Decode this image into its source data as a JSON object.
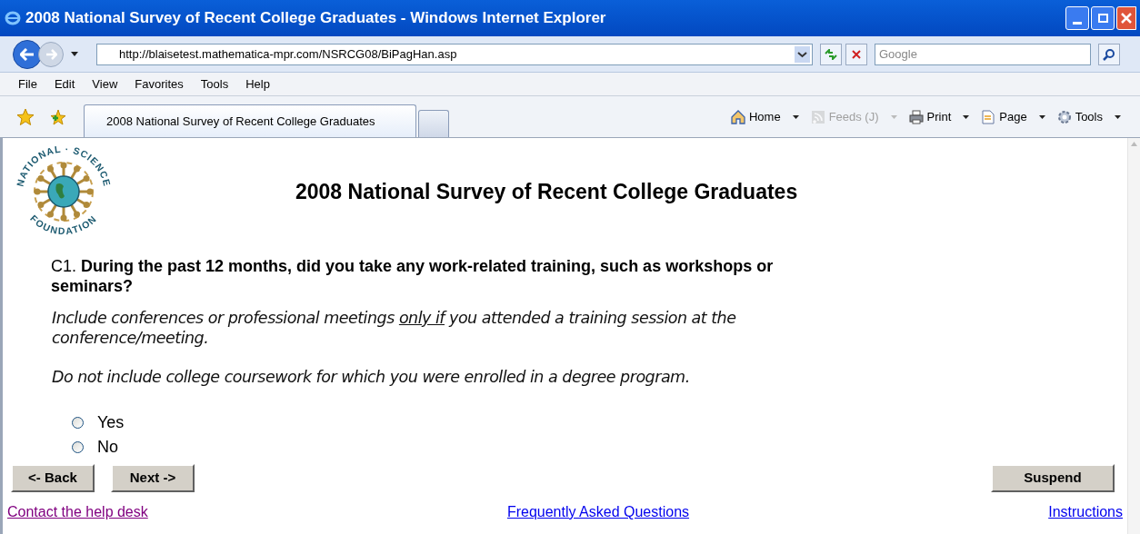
{
  "window": {
    "title": "2008 National Survey of Recent College Graduates - Windows Internet Explorer"
  },
  "address_bar": {
    "url": "http://blaisetest.mathematica-mpr.com/NSRCG08/BiPagHan.asp",
    "search_placeholder": "Google"
  },
  "menu": [
    "File",
    "Edit",
    "View",
    "Favorites",
    "Tools",
    "Help"
  ],
  "tabs": [
    {
      "label": "2008 National Survey of Recent College Graduates",
      "selected": true
    },
    {
      "selected": false
    }
  ],
  "command_bar": [
    {
      "label": "Home",
      "disabled": false,
      "kind": "home"
    },
    {
      "label": "Feeds (J)",
      "disabled": true,
      "kind": "feeds"
    },
    {
      "label": "Print",
      "disabled": false,
      "kind": "print"
    },
    {
      "label": "Page",
      "disabled": false,
      "kind": "page"
    },
    {
      "label": "Tools",
      "disabled": false,
      "kind": "tools"
    }
  ],
  "page": {
    "logo_text": {
      "top": "NATIONAL · SCIENCE",
      "bottom": "FOUNDATION"
    },
    "heading": "2008 National Survey of Recent College Graduates",
    "question_number": "C1.",
    "question": "During the past 12 months, did you take any work-related training, such as workshops or seminars?",
    "notes": [
      [
        {
          "text": "Include conferences or professional meetings ",
          "underlined": false
        },
        {
          "text": "only if",
          "underlined": true
        },
        {
          "text": " you attended a training session at the conference/meeting.",
          "underlined": false
        }
      ],
      [
        {
          "text": "Do not include college coursework for which you were enrolled in a degree program.",
          "underlined": false
        }
      ]
    ],
    "options": [
      {
        "label": "Yes",
        "selected": false
      },
      {
        "label": "No",
        "selected": false
      }
    ],
    "buttons": {
      "back": "<- Back",
      "next": "Next ->",
      "suspend": "Suspend"
    },
    "links": [
      {
        "label": "Contact the help desk",
        "visited": true
      },
      {
        "label": "Frequently Asked Questions",
        "visited": false
      },
      {
        "label": "Instructions",
        "visited": false
      }
    ]
  }
}
